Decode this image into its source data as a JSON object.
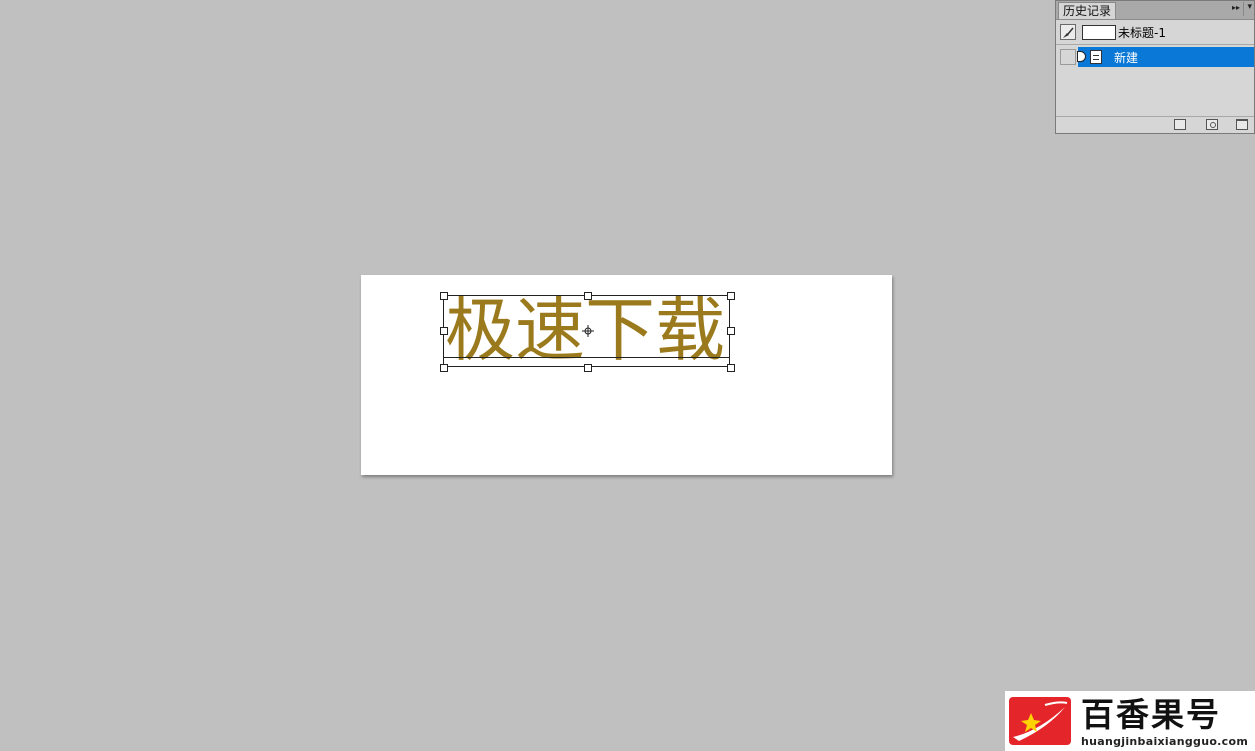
{
  "history_panel": {
    "tab_label": "历史记录",
    "menu_glyph": "▸▸",
    "close_glyph": "▾",
    "snapshot_label": "未标题-1",
    "state_label": "新建"
  },
  "canvas": {
    "text": "极速下载",
    "text_color": "#9a7a1c"
  },
  "watermark": {
    "title": "百香果号",
    "url": "huangjinbaixiangguo.com",
    "logo_color": "#e4262a"
  }
}
